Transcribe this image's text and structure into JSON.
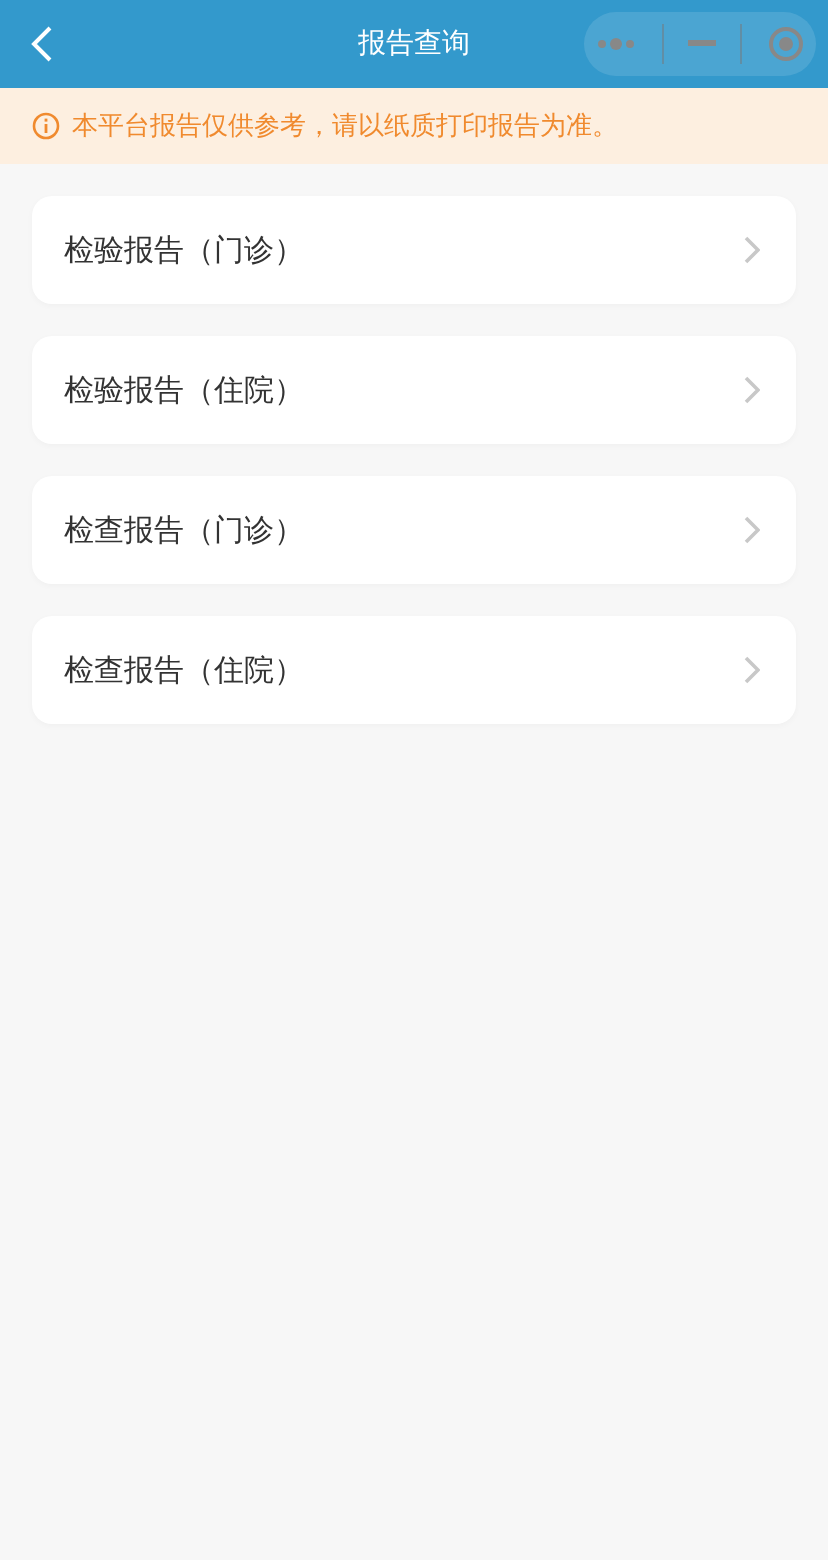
{
  "header": {
    "title": "报告查询"
  },
  "notice": {
    "text": "本平台报告仅供参考，请以纸质打印报告为准。"
  },
  "items": [
    {
      "label": "检验报告（门诊）"
    },
    {
      "label": "检验报告（住院）"
    },
    {
      "label": "检查报告（门诊）"
    },
    {
      "label": "检查报告（住院）"
    }
  ]
}
